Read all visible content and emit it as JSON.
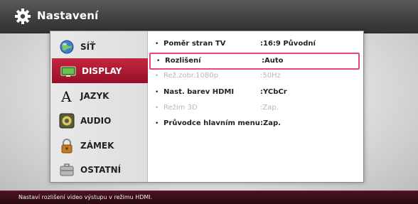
{
  "header": {
    "title": "Nastavení",
    "icon": "gear-icon"
  },
  "sidebar": {
    "items": [
      {
        "label": "SÍŤ",
        "icon": "network-globe-icon"
      },
      {
        "label": "DISPLAY",
        "icon": "display-icon",
        "active": true
      },
      {
        "label": "JAZYK",
        "icon": "language-icon"
      },
      {
        "label": "AUDIO",
        "icon": "speaker-icon"
      },
      {
        "label": "ZÁMEK",
        "icon": "lock-icon"
      },
      {
        "label": "OSTATNÍ",
        "icon": "briefcase-icon"
      }
    ]
  },
  "settings": {
    "rows": [
      {
        "bullet": "•",
        "name": "Poměr stran TV",
        "value": ":16:9 Původní",
        "state": "normal"
      },
      {
        "bullet": "•",
        "name": "Rozlišení",
        "value": ":Auto",
        "state": "selected"
      },
      {
        "bullet": "•",
        "name": "Rež.zobr.1080p",
        "value": ":50Hz",
        "state": "disabled"
      },
      {
        "bullet": "•",
        "name": "Nast. barev HDMI",
        "value": ":YCbCr",
        "state": "normal"
      },
      {
        "bullet": "•",
        "name": "Režim 3D",
        "value": ":Zap.",
        "state": "disabled"
      },
      {
        "bullet": "•",
        "name": "Průvodce hlavním menu",
        "value": ":Zap.",
        "state": "normal"
      }
    ]
  },
  "footer": {
    "hint": "Nastaví rozlišení video výstupu v režimu HDMI."
  },
  "colors": {
    "accent_active": "#b01a34",
    "selection_border": "#e8467a",
    "topbar": "#444444",
    "bottombar": "#3a0e18"
  }
}
